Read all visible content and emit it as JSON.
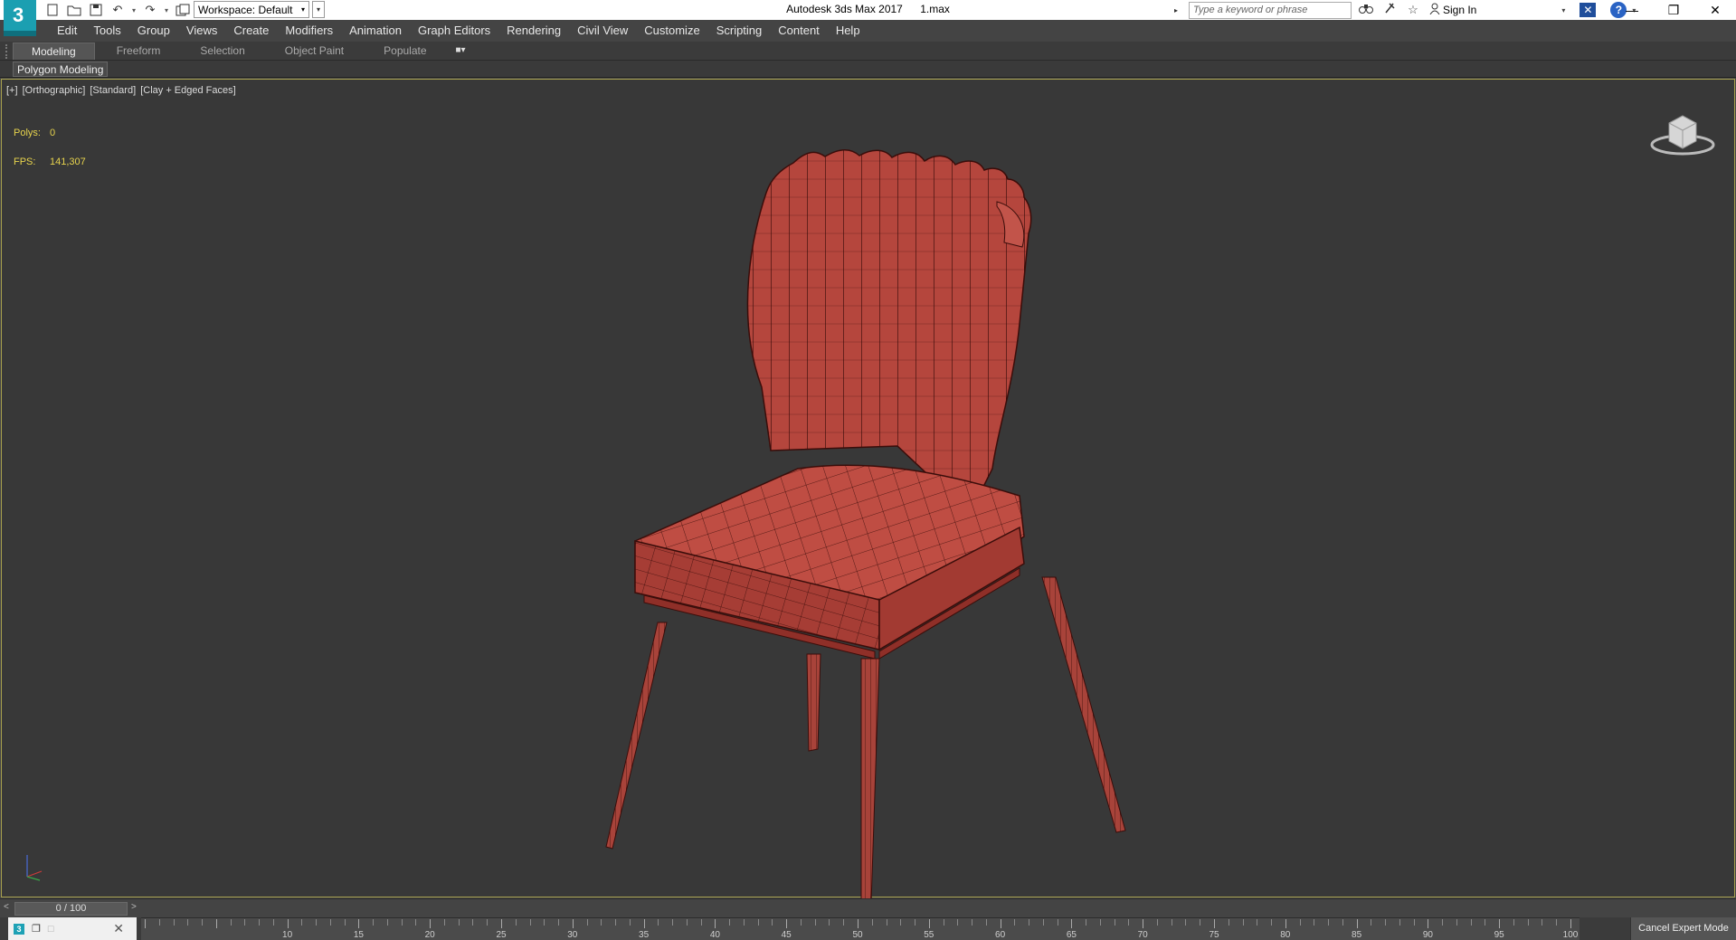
{
  "titlebar": {
    "workspace_label": "Workspace: Default",
    "app_name": "Autodesk 3ds Max 2017",
    "file_name": "1.max",
    "search_placeholder": "Type a keyword or phrase",
    "sign_in": "Sign In"
  },
  "menu": {
    "items": [
      "Edit",
      "Tools",
      "Group",
      "Views",
      "Create",
      "Modifiers",
      "Animation",
      "Graph Editors",
      "Rendering",
      "Civil View",
      "Customize",
      "Scripting",
      "Content",
      "Help"
    ]
  },
  "ribbon": {
    "tabs": [
      "Modeling",
      "Freeform",
      "Selection",
      "Object Paint",
      "Populate"
    ],
    "active_tab": "Modeling",
    "subtab": "Polygon Modeling"
  },
  "viewport": {
    "label_plus": "[+]",
    "label_view": "[Orthographic]",
    "label_shading_mode": "[Standard]",
    "label_style": "[Clay + Edged Faces]",
    "polys_label": "Polys:",
    "polys_value": "0",
    "fps_label": "FPS:",
    "fps_value": "141,307",
    "model_color": "#b5463d",
    "model_edge_color": "#3a0d0a",
    "stats_color": "#e8d44d",
    "border_color": "#a8a14e"
  },
  "timeline": {
    "slider_value": "0 / 100",
    "ruler_labels": [
      "10",
      "15",
      "20",
      "25",
      "30",
      "35",
      "40",
      "45",
      "50",
      "55",
      "60",
      "65",
      "70",
      "75",
      "80",
      "85",
      "90",
      "95",
      "100"
    ],
    "cancel_expert": "Cancel Expert Mode"
  },
  "icons": [
    "app-logo-icon",
    "new-file-icon",
    "open-file-icon",
    "save-icon",
    "undo-icon",
    "redo-icon",
    "project-icon",
    "binoculars-icon",
    "pin-icon",
    "star-icon",
    "user-icon",
    "exchange-icon",
    "help-icon",
    "minimize-icon",
    "restore-icon",
    "close-icon",
    "view-cube-icon",
    "axis-tripod-icon"
  ]
}
